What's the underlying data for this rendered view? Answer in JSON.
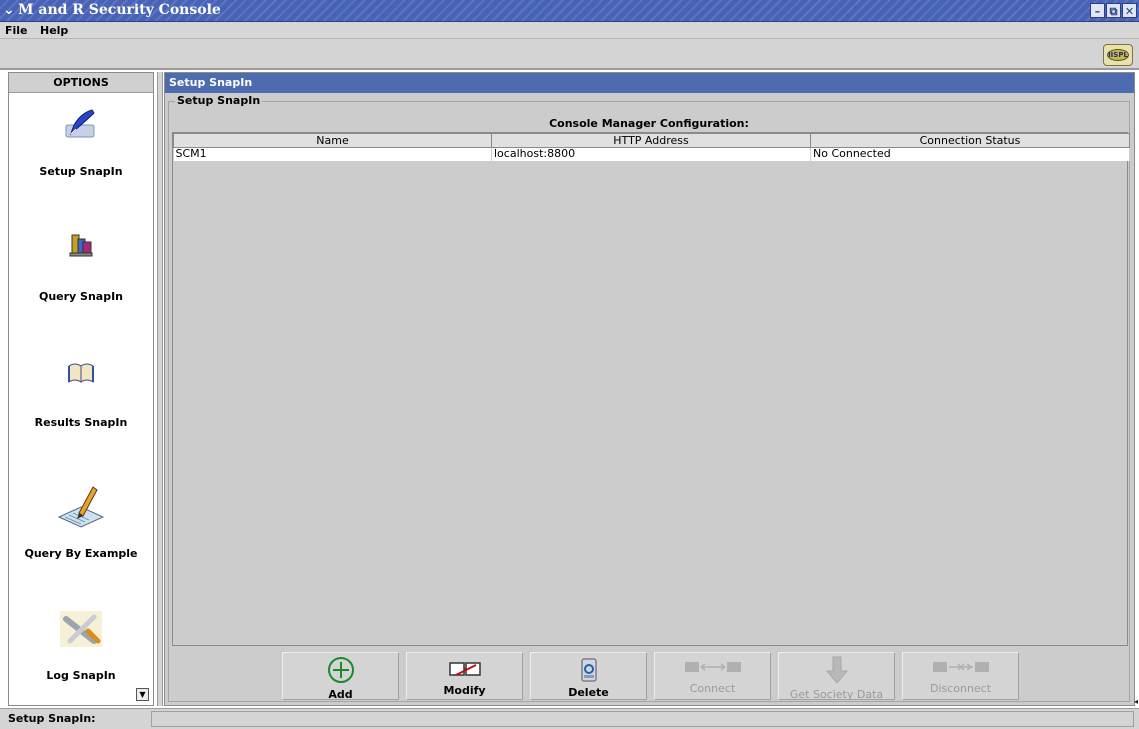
{
  "window": {
    "title": "M and R Security Console",
    "controls": [
      "–",
      "⧉",
      "✕"
    ]
  },
  "menu": [
    "File",
    "Help"
  ],
  "toolbar": {
    "logo_text": "IISPL"
  },
  "options": {
    "header": "OPTIONS",
    "items": [
      {
        "label": "Setup SnapIn",
        "icon": "feather-quill-icon"
      },
      {
        "label": "Query SnapIn",
        "icon": "books-icon"
      },
      {
        "label": "Results SnapIn",
        "icon": "open-book-icon"
      },
      {
        "label": "Query By Example",
        "icon": "pencil-paper-icon"
      },
      {
        "label": "Log SnapIn",
        "icon": "tools-icon"
      }
    ]
  },
  "content": {
    "header": "Setup SnapIn",
    "group_title": "Setup SnapIn",
    "section_title": "Console Manager Configuration:",
    "table": {
      "columns": [
        "Name",
        "HTTP Address",
        "Connection Status"
      ],
      "rows": [
        {
          "name": "SCM1",
          "address": "localhost:8800",
          "status": "No Connected"
        }
      ]
    },
    "buttons": [
      {
        "label": "Add",
        "icon": "add-circle-icon",
        "enabled": true
      },
      {
        "label": "Modify",
        "icon": "modify-icon",
        "enabled": true
      },
      {
        "label": "Delete",
        "icon": "trash-icon",
        "enabled": true
      },
      {
        "label": "Connect",
        "icon": "connect-icon",
        "enabled": false
      },
      {
        "label": "Get Society Data",
        "icon": "down-arrow-icon",
        "enabled": false
      },
      {
        "label": "Disconnect",
        "icon": "disconnect-icon",
        "enabled": false
      }
    ]
  },
  "status_bar": {
    "text": "Setup SnapIn:"
  },
  "colors": {
    "title_bar": "#4862b6",
    "content_header": "#4d6cb0",
    "panel_bg": "#cccccc",
    "chrome_bg": "#d4d4d4"
  }
}
